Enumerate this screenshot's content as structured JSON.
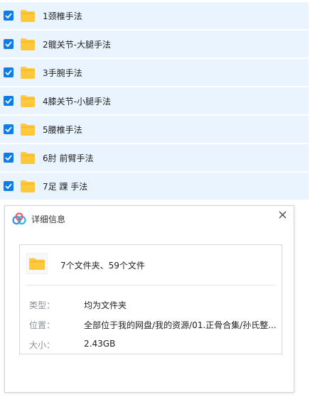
{
  "files": [
    {
      "name": "1颈椎手法",
      "checked": true
    },
    {
      "name": "2髋关节-大腿手法",
      "checked": true
    },
    {
      "name": "3手腕手法",
      "checked": true
    },
    {
      "name": "4膝关节-小腿手法",
      "checked": true
    },
    {
      "name": "5腰椎手法",
      "checked": true
    },
    {
      "name": "6肘 前臂手法",
      "checked": true
    },
    {
      "name": "7足 踝 手法",
      "checked": true
    }
  ],
  "dialog": {
    "title": "详细信息",
    "summary": "7个文件夹、59个文件",
    "type_label": "类型：",
    "type_value": "均为文件夹",
    "location_label": "位置：",
    "location_value": "全部位于我的网盘/我的资源/01.正骨合集/孙氏整...",
    "size_label": "大小：",
    "size_value": "2.43GB"
  },
  "colors": {
    "row_bg": "#eaf4fe",
    "checkbox": "#0d7ee6",
    "folder": "#ffc83d"
  }
}
